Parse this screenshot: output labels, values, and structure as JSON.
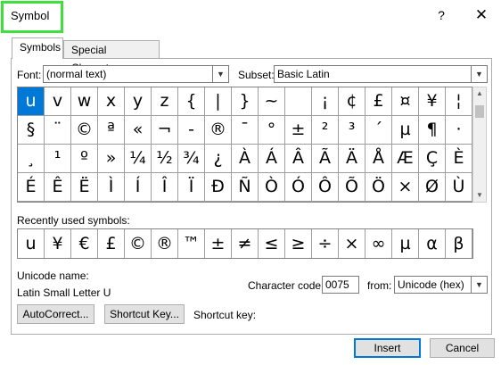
{
  "window": {
    "title": "Symbol",
    "help_label": "?",
    "close_label": "✕"
  },
  "tabs": [
    {
      "label": "Symbols",
      "active": true
    },
    {
      "label": "Special Characters",
      "active": false
    }
  ],
  "font": {
    "label": "Font:",
    "value": "(normal text)"
  },
  "subset": {
    "label": "Subset:",
    "value": "Basic Latin"
  },
  "grid": {
    "rows": [
      [
        "u",
        "v",
        "w",
        "x",
        "y",
        "z",
        "{",
        "|",
        "}",
        "~",
        "",
        "¡",
        "¢",
        "£",
        "¤",
        "¥",
        "¦"
      ],
      [
        "§",
        "¨",
        "©",
        "ª",
        "«",
        "¬",
        "-",
        "®",
        "¯",
        "°",
        "±",
        "²",
        "³",
        "´",
        "µ",
        "¶",
        "·"
      ],
      [
        "¸",
        "¹",
        "º",
        "»",
        "¼",
        "½",
        "¾",
        "¿",
        "À",
        "Á",
        "Â",
        "Ã",
        "Ä",
        "Å",
        "Æ",
        "Ç",
        "È"
      ],
      [
        "É",
        "Ê",
        "Ë",
        "Ì",
        "Í",
        "Î",
        "Ï",
        "Ð",
        "Ñ",
        "Ò",
        "Ó",
        "Ô",
        "Õ",
        "Ö",
        "×",
        "Ø",
        "Ù"
      ]
    ],
    "selected": "u"
  },
  "recent": {
    "label": "Recently used symbols:",
    "symbols": [
      "u",
      "¥",
      "€",
      "£",
      "©",
      "®",
      "™",
      "±",
      "≠",
      "≤",
      "≥",
      "÷",
      "×",
      "∞",
      "µ",
      "α",
      "β"
    ]
  },
  "unicode": {
    "name_label": "Unicode name:",
    "name_value": "Latin Small Letter U",
    "code_label": "Character code:",
    "code_value": "0075",
    "from_label": "from:",
    "from_value": "Unicode (hex)"
  },
  "buttons": {
    "autocorrect": "AutoCorrect...",
    "shortcut_key": "Shortcut Key...",
    "shortcut_key_label": "Shortcut key:",
    "insert": "Insert",
    "cancel": "Cancel"
  },
  "colors": {
    "selection": "#0078d7",
    "highlight_box": "#3ee03e"
  }
}
